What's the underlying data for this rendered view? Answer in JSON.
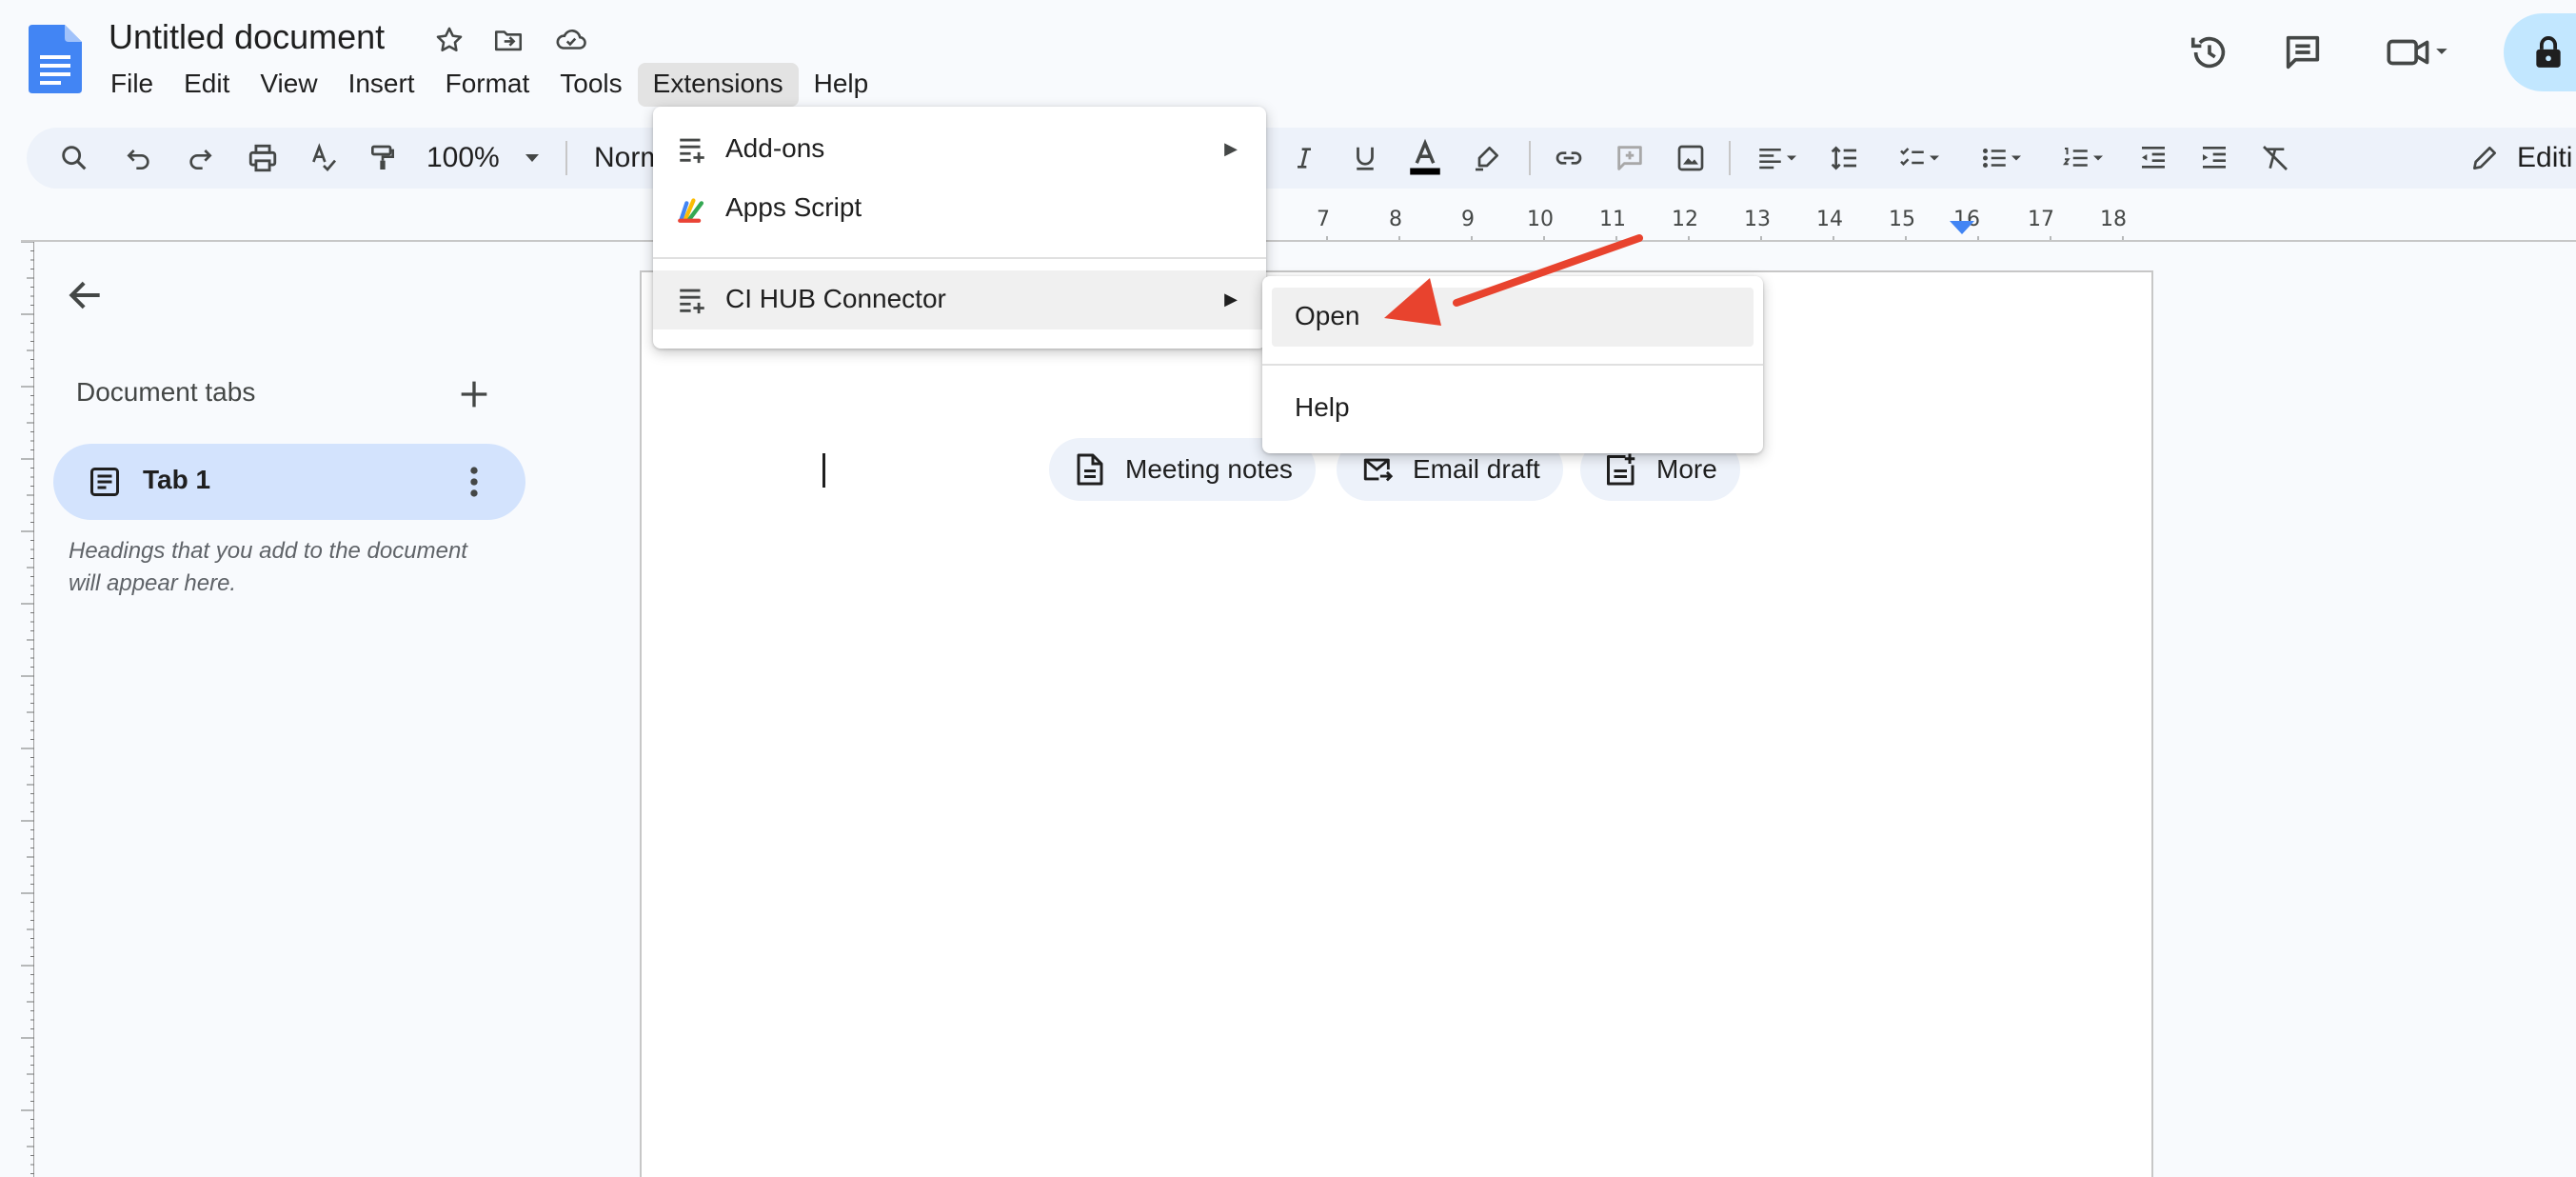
{
  "document": {
    "title": "Untitled document"
  },
  "menubar": {
    "items": [
      {
        "label": "File",
        "active": false
      },
      {
        "label": "Edit",
        "active": false
      },
      {
        "label": "View",
        "active": false
      },
      {
        "label": "Insert",
        "active": false
      },
      {
        "label": "Format",
        "active": false
      },
      {
        "label": "Tools",
        "active": false
      },
      {
        "label": "Extensions",
        "active": true
      },
      {
        "label": "Help",
        "active": false
      }
    ]
  },
  "toolbar": {
    "zoom": "100%",
    "paragraph_style": "Norm",
    "edit_mode": "Editi"
  },
  "ruler": {
    "numbers": [
      "7",
      "8",
      "9",
      "10",
      "11",
      "12",
      "13",
      "14",
      "15",
      "16",
      "17",
      "18"
    ]
  },
  "sidebar": {
    "heading": "Document tabs",
    "tab": {
      "label": "Tab 1"
    },
    "hint": "Headings that you add to the document will appear here."
  },
  "chips": [
    {
      "label": "Meeting notes",
      "icon": "document-icon"
    },
    {
      "label": "Email draft",
      "icon": "email-icon"
    },
    {
      "label": "More",
      "icon": "more-templates-icon"
    }
  ],
  "extensions_menu": {
    "items": [
      {
        "label": "Add-ons",
        "icon": "add-ons-icon",
        "has_submenu": true
      },
      {
        "label": "Apps Script",
        "icon": "apps-script-icon",
        "has_submenu": false
      },
      {
        "label": "CI HUB Connector",
        "icon": "add-ons-icon",
        "has_submenu": true
      }
    ]
  },
  "submenu": {
    "items": [
      {
        "label": "Open"
      },
      {
        "label": "Help"
      }
    ]
  },
  "colors": {
    "accent": "#0b57d0",
    "doc_blue": "#4285f4",
    "annotation_red": "#e8432e",
    "toolbar_bg": "#edf2fa",
    "tab_selected_bg": "#d3e3fd"
  }
}
